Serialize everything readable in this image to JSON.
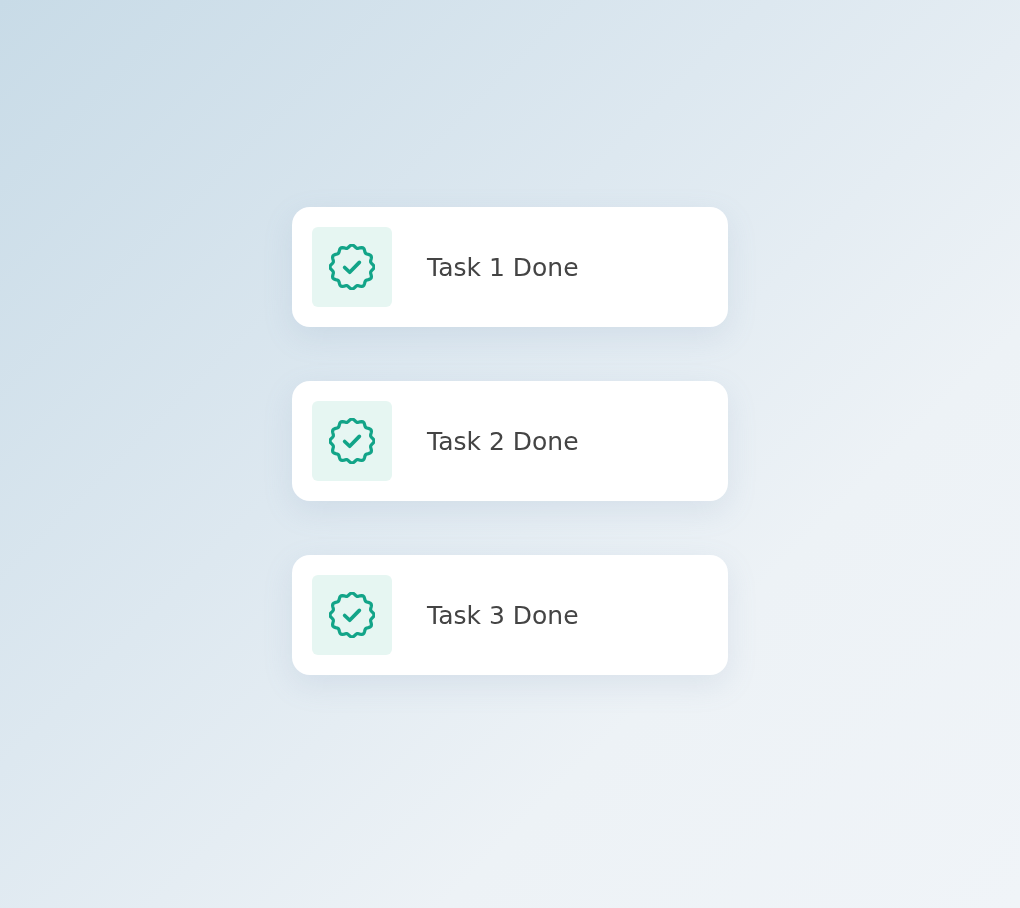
{
  "tasks": [
    {
      "label": "Task 1 Done"
    },
    {
      "label": "Task 2 Done"
    },
    {
      "label": "Task 3 Done"
    }
  ]
}
